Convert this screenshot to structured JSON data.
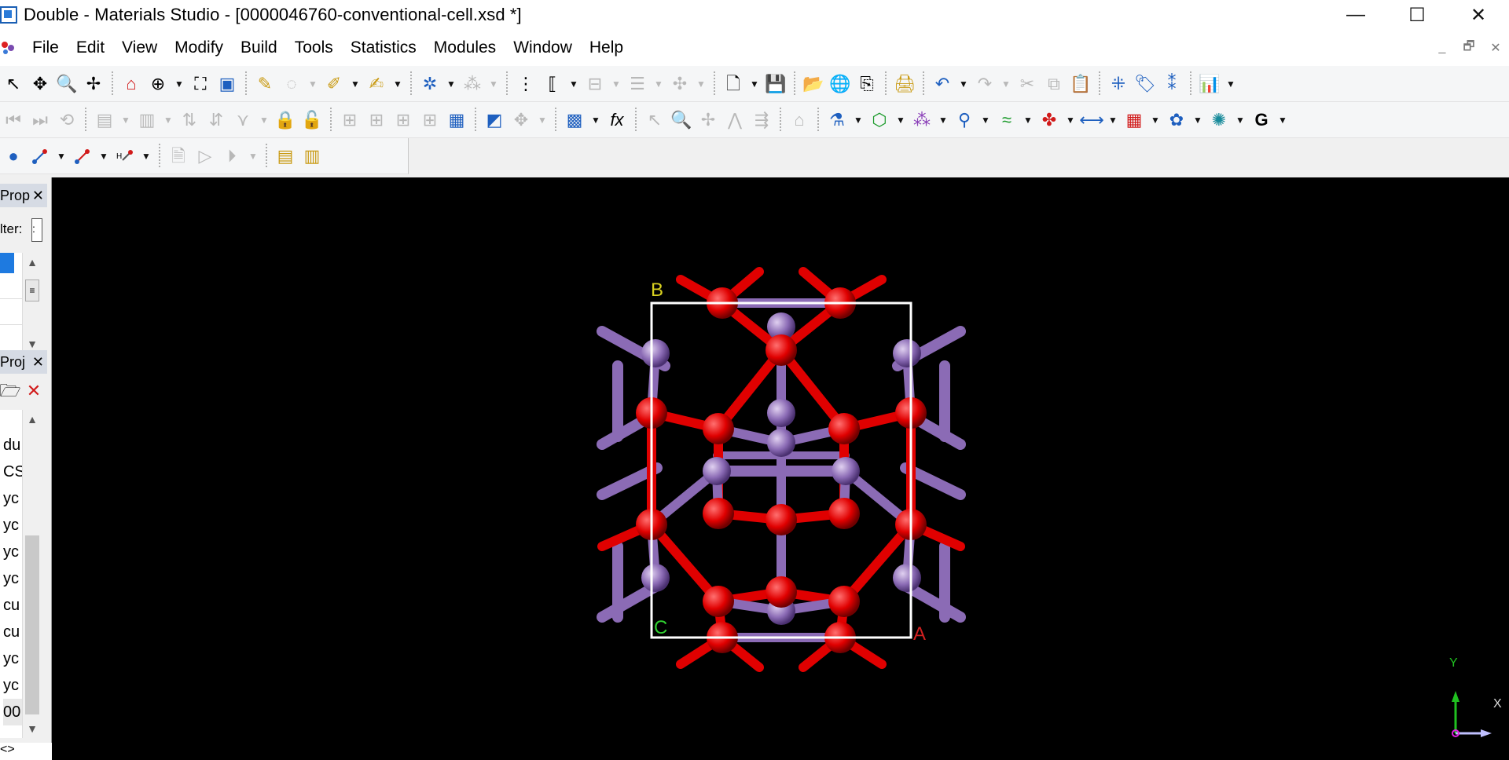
{
  "window": {
    "title": "Double - Materials Studio - [0000046760-conventional-cell.xsd *]",
    "controls": {
      "minimize": "—",
      "maximize": "☐",
      "close": "✕"
    }
  },
  "menu": {
    "items": [
      "File",
      "Edit",
      "View",
      "Modify",
      "Build",
      "Tools",
      "Statistics",
      "Modules",
      "Window",
      "Help"
    ],
    "mdi_controls": {
      "minimize": "_",
      "restore": "🗗",
      "close": "✕"
    }
  },
  "left_panels": {
    "properties": {
      "title": "Prop",
      "close": "✕",
      "filter_label": "lter:",
      "filter_value": ":"
    },
    "project": {
      "title": "Proj",
      "close": "✕",
      "items": [
        "du",
        "CS",
        "yc",
        "yc",
        "yc",
        "yc",
        "cu",
        "cu",
        "yc",
        "yc",
        "00"
      ]
    },
    "scroll_up": "▲",
    "scroll_down": "▼",
    "bottom_arrows": "<>"
  },
  "viewport": {
    "cell_labels": {
      "b": "B",
      "c": "C",
      "a": "A"
    },
    "axes": {
      "y": "Y",
      "x": "X"
    }
  },
  "colors": {
    "oxygen": "#e00000",
    "metal": "#8b6bb5",
    "background": "#000000",
    "cell": "#ffffff"
  }
}
